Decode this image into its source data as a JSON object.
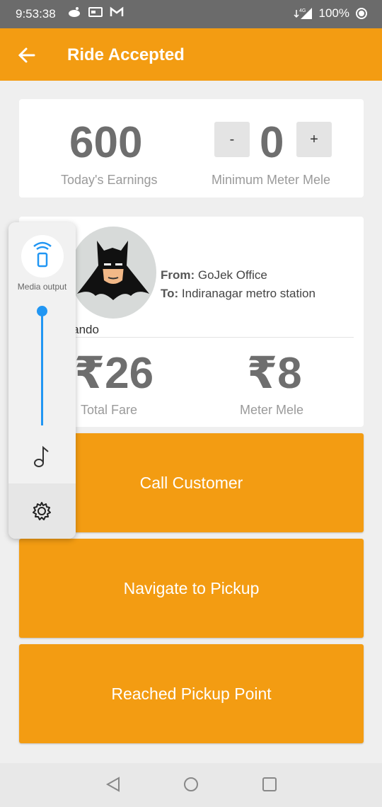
{
  "status_bar": {
    "time": "9:53:38",
    "network": "4G",
    "battery": "100%",
    "icons_left": [
      "notification-icon",
      "card-icon",
      "gmail-icon"
    ]
  },
  "app_bar": {
    "title": "Ride Accepted",
    "back_icon": "back-arrow-icon",
    "color": "#f39c12"
  },
  "earnings": {
    "value": "600",
    "label": "Today's Earnings",
    "meter_value": "0",
    "meter_label": "Minimum Meter Mele",
    "minus_label": "-",
    "plus_label": "+"
  },
  "ride": {
    "customer_name": "rnando",
    "from_label": "From:",
    "from_value": "GoJek Office",
    "to_label": "To:",
    "to_value": "Indiranagar metro station",
    "fare": "₹26",
    "fare_label": "Total Fare",
    "meter": "₹8",
    "meter_label": "Meter Mele"
  },
  "actions": [
    {
      "label": "Call Customer"
    },
    {
      "label": "Navigate to Pickup"
    },
    {
      "label": "Reached Pickup Point"
    }
  ],
  "volume_panel": {
    "output_label": "Media output",
    "level": 1.0,
    "accent": "#2196f3"
  },
  "nav": [
    "back-triangle-icon",
    "home-circle-icon",
    "recents-square-icon"
  ]
}
